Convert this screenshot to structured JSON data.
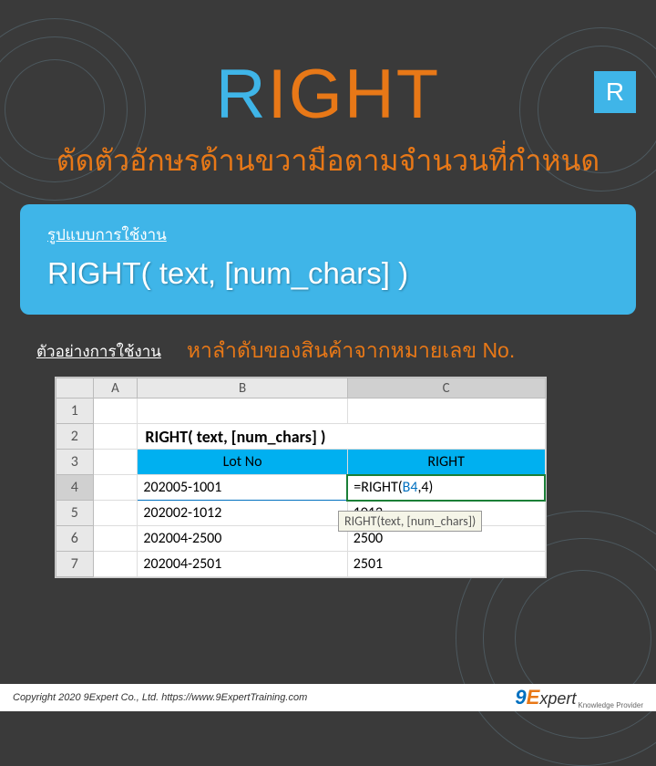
{
  "badge": "R",
  "title": {
    "first": "R",
    "rest": "IGHT"
  },
  "subtitle": "ตัดตัวอักษรด้านขวามือตามจำนวนที่กำหนด",
  "syntax": {
    "label": "รูปแบบการใช้งาน",
    "text": "RIGHT( text, [num_chars] )"
  },
  "example": {
    "label": "ตัวอย่างการใช้งาน",
    "desc": "หาลำดับของสินค้าจากหมายเลข No."
  },
  "excel": {
    "cols": [
      "",
      "A",
      "B",
      "C"
    ],
    "title_row": "RIGHT( text, [num_chars] )",
    "headers": {
      "b": "Lot No",
      "c": "RIGHT"
    },
    "rows": [
      {
        "n": "4",
        "b": "202005-1001",
        "c_prefix": "=RIGHT(",
        "c_ref": "B4",
        "c_suffix": ",4)",
        "sel": true
      },
      {
        "n": "5",
        "b": "202002-1012",
        "c": "1012"
      },
      {
        "n": "6",
        "b": "202004-2500",
        "c": "2500"
      },
      {
        "n": "7",
        "b": "202004-2501",
        "c": "2501"
      }
    ],
    "tooltip": "RIGHT(text, [num_chars])"
  },
  "footer": {
    "copyright": "Copyright 2020 9Expert Co., Ltd.   https://www.9ExpertTraining.com",
    "logo_9": "9",
    "logo_e": "E",
    "logo_rest": "xpert",
    "logo_sub": "Knowledge Provider"
  }
}
